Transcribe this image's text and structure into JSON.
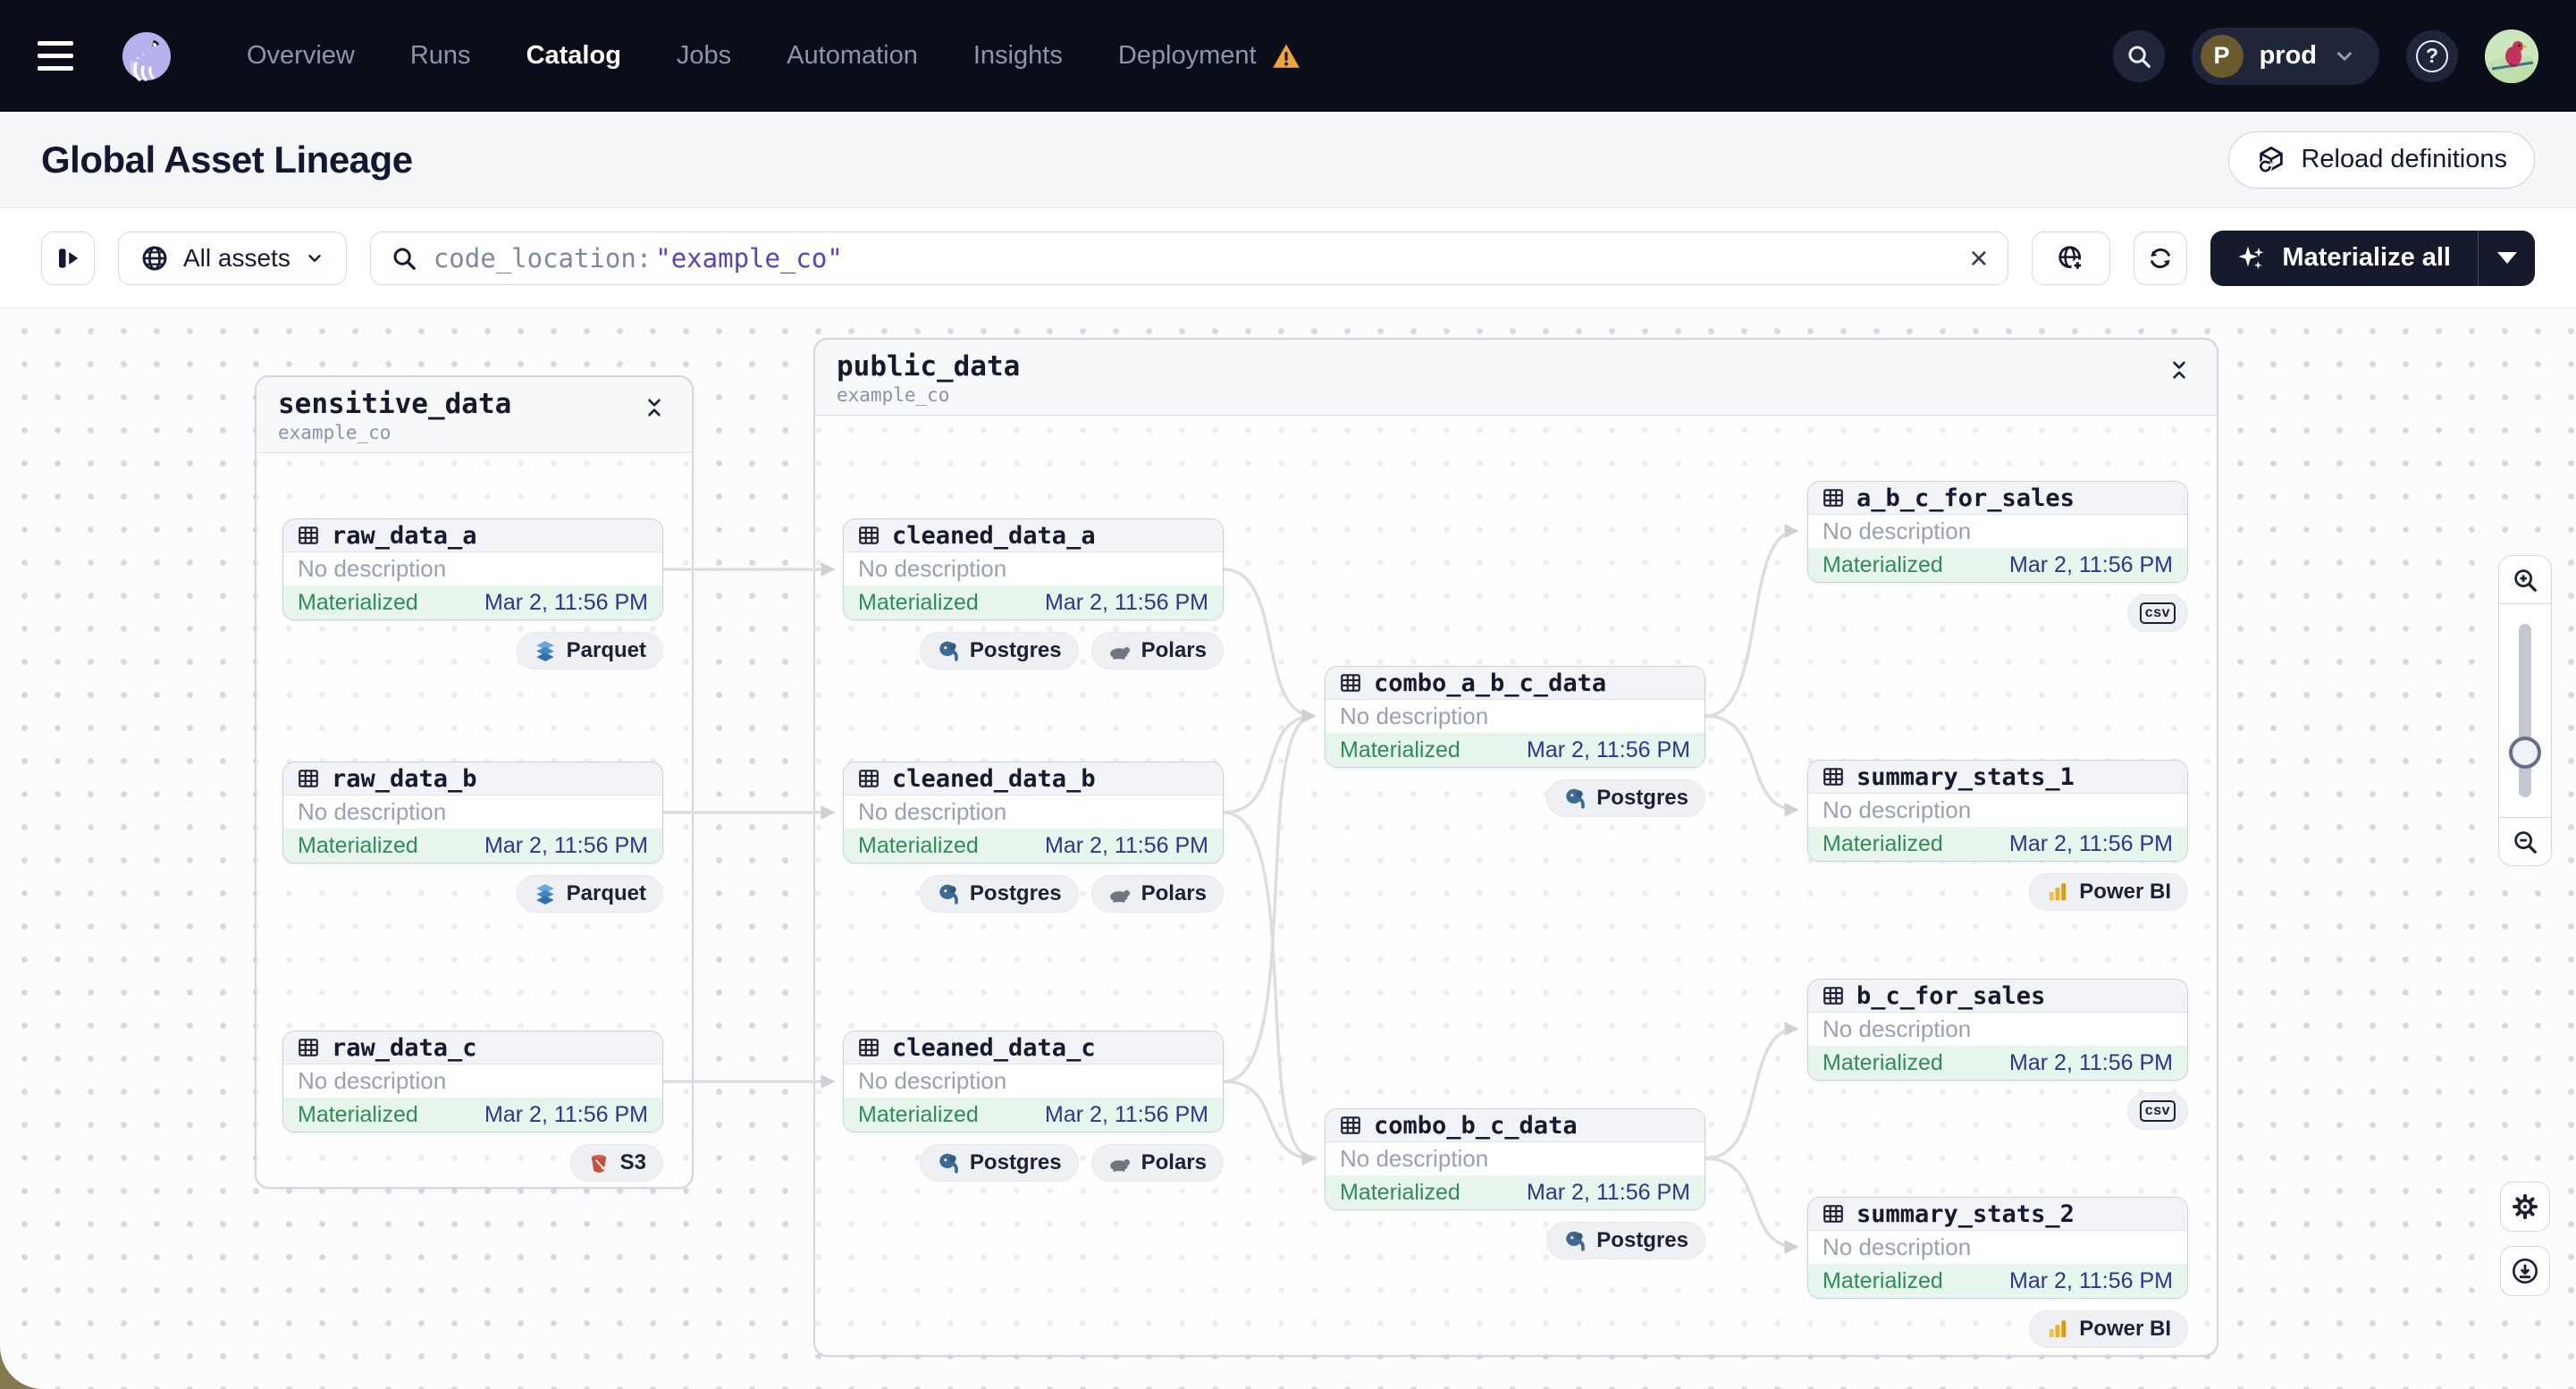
{
  "nav": {
    "items": [
      {
        "label": "Overview",
        "active": false
      },
      {
        "label": "Runs",
        "active": false
      },
      {
        "label": "Catalog",
        "active": true
      },
      {
        "label": "Jobs",
        "active": false
      },
      {
        "label": "Automation",
        "active": false
      },
      {
        "label": "Insights",
        "active": false
      },
      {
        "label": "Deployment",
        "active": false,
        "has_warning": true
      }
    ],
    "env": {
      "initial": "P",
      "name": "prod"
    },
    "help_glyph": "?"
  },
  "header": {
    "title": "Global Asset Lineage",
    "reload_label": "Reload definitions"
  },
  "toolbar": {
    "scope_label": "All assets",
    "search": {
      "key": "code_location:",
      "term": "\"example_co\"",
      "clear_glyph": "×"
    },
    "materialize_label": "Materialize all"
  },
  "graph": {
    "groups": [
      {
        "name": "sensitive_data",
        "subtitle": "example_co"
      },
      {
        "name": "public_data",
        "subtitle": "example_co"
      }
    ],
    "nodes": [
      {
        "name": "raw_data_a",
        "description": "No description",
        "status": "Materialized",
        "timestamp": "Mar 2, 11:56 PM",
        "tags": [
          {
            "label": "Parquet",
            "icon": "parquet-icon"
          }
        ]
      },
      {
        "name": "raw_data_b",
        "description": "No description",
        "status": "Materialized",
        "timestamp": "Mar 2, 11:56 PM",
        "tags": [
          {
            "label": "Parquet",
            "icon": "parquet-icon"
          }
        ]
      },
      {
        "name": "raw_data_c",
        "description": "No description",
        "status": "Materialized",
        "timestamp": "Mar 2, 11:56 PM",
        "tags": [
          {
            "label": "S3",
            "icon": "s3-icon"
          }
        ]
      },
      {
        "name": "cleaned_data_a",
        "description": "No description",
        "status": "Materialized",
        "timestamp": "Mar 2, 11:56 PM",
        "tags": [
          {
            "label": "Postgres",
            "icon": "postgres-icon"
          },
          {
            "label": "Polars",
            "icon": "polars-icon"
          }
        ]
      },
      {
        "name": "cleaned_data_b",
        "description": "No description",
        "status": "Materialized",
        "timestamp": "Mar 2, 11:56 PM",
        "tags": [
          {
            "label": "Postgres",
            "icon": "postgres-icon"
          },
          {
            "label": "Polars",
            "icon": "polars-icon"
          }
        ]
      },
      {
        "name": "cleaned_data_c",
        "description": "No description",
        "status": "Materialized",
        "timestamp": "Mar 2, 11:56 PM",
        "tags": [
          {
            "label": "Postgres",
            "icon": "postgres-icon"
          },
          {
            "label": "Polars",
            "icon": "polars-icon"
          }
        ]
      },
      {
        "name": "combo_a_b_c_data",
        "description": "No description",
        "status": "Materialized",
        "timestamp": "Mar 2, 11:56 PM",
        "tags": [
          {
            "label": "Postgres",
            "icon": "postgres-icon"
          }
        ]
      },
      {
        "name": "a_b_c_for_sales",
        "description": "No description",
        "status": "Materialized",
        "timestamp": "Mar 2, 11:56 PM",
        "tags": [
          {
            "icon": "csv-icon",
            "icon_text": "csv"
          }
        ]
      },
      {
        "name": "summary_stats_1",
        "description": "No description",
        "status": "Materialized",
        "timestamp": "Mar 2, 11:56 PM",
        "tags": [
          {
            "label": "Power BI",
            "icon": "powerbi-icon"
          }
        ]
      },
      {
        "name": "b_c_for_sales",
        "description": "No description",
        "status": "Materialized",
        "timestamp": "Mar 2, 11:56 PM",
        "tags": [
          {
            "icon": "csv-icon",
            "icon_text": "csv"
          }
        ]
      },
      {
        "name": "combo_b_c_data",
        "description": "No description",
        "status": "Materialized",
        "timestamp": "Mar 2, 11:56 PM",
        "tags": [
          {
            "label": "Postgres",
            "icon": "postgres-icon"
          }
        ]
      },
      {
        "name": "summary_stats_2",
        "description": "No description",
        "status": "Materialized",
        "timestamp": "Mar 2, 11:56 PM",
        "tags": [
          {
            "label": "Power BI",
            "icon": "powerbi-icon"
          }
        ]
      }
    ],
    "edges": [
      {
        "from": "raw_data_a",
        "to": "cleaned_data_a"
      },
      {
        "from": "raw_data_b",
        "to": "cleaned_data_b"
      },
      {
        "from": "raw_data_c",
        "to": "cleaned_data_c"
      },
      {
        "from": "cleaned_data_a",
        "to": "combo_a_b_c_data"
      },
      {
        "from": "cleaned_data_b",
        "to": "combo_a_b_c_data"
      },
      {
        "from": "cleaned_data_c",
        "to": "combo_a_b_c_data"
      },
      {
        "from": "cleaned_data_b",
        "to": "combo_b_c_data"
      },
      {
        "from": "cleaned_data_c",
        "to": "combo_b_c_data"
      },
      {
        "from": "combo_a_b_c_data",
        "to": "a_b_c_for_sales"
      },
      {
        "from": "combo_a_b_c_data",
        "to": "summary_stats_1"
      },
      {
        "from": "combo_b_c_data",
        "to": "b_c_for_sales"
      },
      {
        "from": "combo_b_c_data",
        "to": "summary_stats_2"
      }
    ]
  },
  "colors": {
    "nav_bg": "#0a0e1b",
    "accent_dark": "#151b2d",
    "materialized_green": "#2f8b58",
    "materialized_bg": "#e7f6ed",
    "timestamp_blue": "#2c3590",
    "search_term_purple": "#5244c2",
    "warning_orange": "#f0a53c"
  },
  "icons": {
    "nav": [
      "menu-icon",
      "dagster-logo",
      "warning-icon",
      "search-icon",
      "chevron-down-icon",
      "help-icon",
      "avatar"
    ],
    "header": [
      "reload-cube-icon"
    ],
    "toolbar": [
      "collapse-panel-icon",
      "globe-icon",
      "search-icon",
      "clear-icon",
      "globe-add-icon",
      "refresh-icon",
      "sparkle-icon",
      "caret-down-icon"
    ],
    "node": [
      "table-icon"
    ],
    "tags": [
      "parquet-icon",
      "s3-icon",
      "postgres-icon",
      "polars-icon",
      "powerbi-icon",
      "csv-icon"
    ],
    "group": [
      "collapse-icon"
    ],
    "canvas_controls": [
      "zoom-in-icon",
      "zoom-slider",
      "zoom-out-icon",
      "settings-gear-icon",
      "download-icon"
    ]
  }
}
